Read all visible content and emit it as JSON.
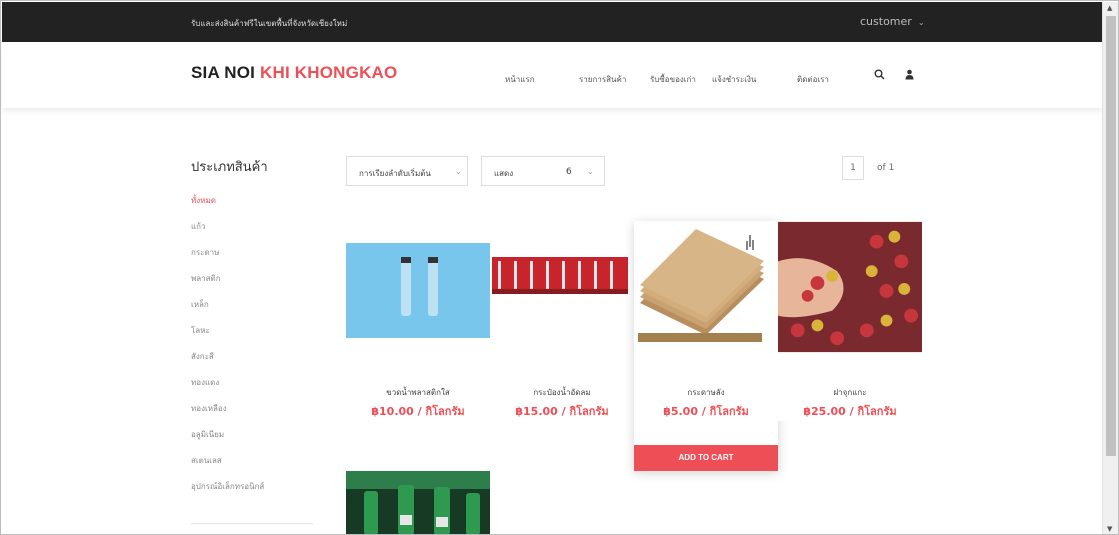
{
  "topbar": {
    "notice": "รับและส่งสินค้าฟรีในเขตพื้นที่จังหวัดเชียงใหม่",
    "customer": "customer"
  },
  "header": {
    "logo_part1": "SIA NOI",
    "logo_part2": "KHI KHONGKAO",
    "nav": [
      "หน้าแรก",
      "รายการสินค้า",
      "รับซื้อของเก่า",
      "แจ้งชำระเงิน",
      "ติดต่อเรา"
    ],
    "icons": [
      "search-icon",
      "user-icon"
    ]
  },
  "sidebar": {
    "title": "ประเภทสินค้า",
    "categories": [
      "ทั้งหมด",
      "แก้ว",
      "กระดาษ",
      "พลาสติก",
      "เหล็ก",
      "โลหะ",
      "สังกะสี",
      "ทองแดง",
      "ทองเหลือง",
      "อลูมิเนียม",
      "สเตนเลส",
      "อุปกรณ์อิเล็กทรอนิกส์"
    ],
    "active_index": 0
  },
  "toolbar": {
    "sort_label": "การเรียงลำดับเริ่มต้น",
    "show_label": "แสดง",
    "show_value": "6",
    "page_current": "1",
    "page_of": "of",
    "page_total": "1"
  },
  "products": [
    {
      "name": "ขวดน้ำพลาสติกใส",
      "price": "฿10.00 / กิโลกรัม"
    },
    {
      "name": "กระป๋องน้ำอัดลม",
      "price": "฿15.00 / กิโลกรัม"
    },
    {
      "name": "กระดาษลัง",
      "price": "฿5.00 / กิโลกรัม",
      "cart_label": "ADD TO CART"
    },
    {
      "name": "ฝาจุกแกะ",
      "price": "฿25.00 / กิโลกรัม"
    }
  ],
  "colors": {
    "accent": "#ee4e55",
    "topbar": "#222222"
  }
}
